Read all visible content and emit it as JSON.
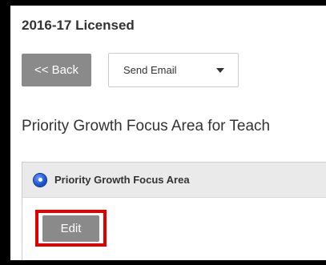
{
  "header": {
    "title": "2016-17 Licensed"
  },
  "toolbar": {
    "back_label": "<< Back",
    "send_email_label": "Send Email"
  },
  "section": {
    "heading": "Priority Growth Focus Area for Teach"
  },
  "panel": {
    "title": "Priority Growth Focus Area",
    "edit_label": "Edit"
  },
  "colors": {
    "button_gray": "#8a8a8a",
    "highlight_red": "#e00000",
    "panel_header_bg": "#eaeaea",
    "icon_blue": "#1f55d8"
  }
}
